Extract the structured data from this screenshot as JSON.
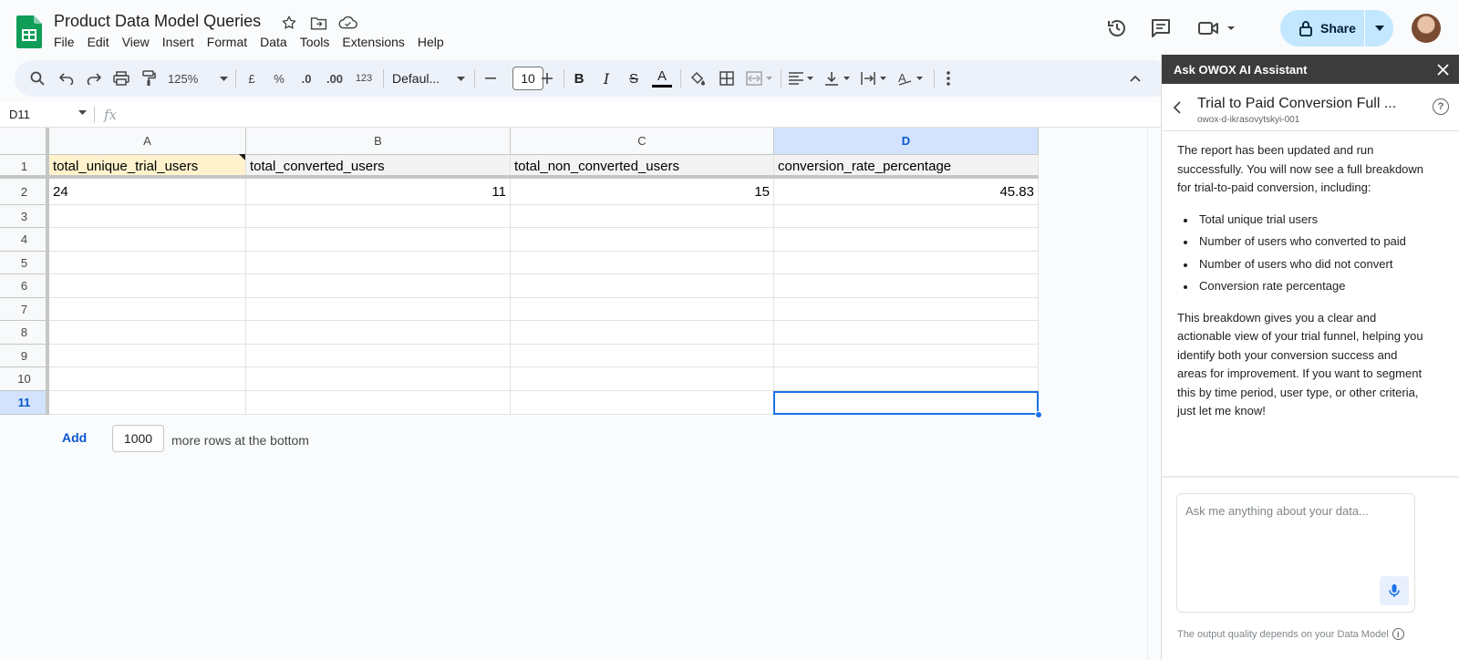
{
  "header": {
    "title": "Product Data Model Queries",
    "menu": [
      "File",
      "Edit",
      "View",
      "Insert",
      "Format",
      "Data",
      "Tools",
      "Extensions",
      "Help"
    ],
    "share_label": "Share"
  },
  "toolbar": {
    "zoom": "125%",
    "currency": "£",
    "percent": "%",
    "dec_decrease": ".0",
    "dec_increase": ".00",
    "more_formats": "123",
    "font": "Defaul...",
    "font_size": "10"
  },
  "formula_bar": {
    "name_box": "D11",
    "fx": "fx"
  },
  "sheet": {
    "columns": [
      "A",
      "B",
      "C",
      "D"
    ],
    "rows": [
      "1",
      "2",
      "3",
      "4",
      "5",
      "6",
      "7",
      "8",
      "9",
      "10",
      "11"
    ],
    "header_cells": [
      "total_unique_trial_users",
      "total_converted_users",
      "total_non_converted_users",
      "conversion_rate_percentage"
    ],
    "data_cells": [
      "24",
      "11",
      "15",
      "45.83"
    ],
    "selected_cell": "D11",
    "add_label": "Add",
    "add_rows_value": "1000",
    "add_rows_suffix": "more rows at the bottom"
  },
  "assistant": {
    "panel_title": "Ask OWOX AI Assistant",
    "report_title": "Trial to Paid Conversion Full ...",
    "report_subtitle": "owox-d-ikrasovytskyi-001",
    "message_intro": "The report has been updated and run successfully. You will now see a full breakdown for trial-to-paid conversion, including:",
    "bullets": [
      "Total unique trial users",
      "Number of users who converted to paid",
      "Number of users who did not convert",
      "Conversion rate percentage"
    ],
    "message_outro": "This breakdown gives you a clear and actionable view of your trial funnel, helping you identify both your conversion success and areas for improvement. If you want to segment this by time period, user type, or other criteria, just let me know!",
    "input_placeholder": "Ask me anything about your data...",
    "footer": "The output quality depends on your Data Model"
  },
  "colors": {
    "accent": "#0b57d0",
    "share_bg": "#c2e7ff",
    "header_highlight": "#fff2cc",
    "selection": "#1a73e8"
  }
}
